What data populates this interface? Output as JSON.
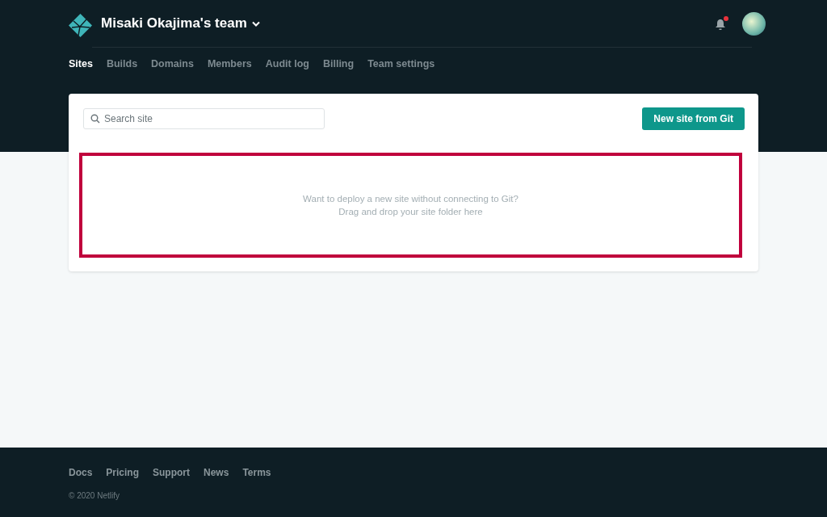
{
  "header": {
    "team_name": "Misaki Okajima's team",
    "notifications": {
      "unread": true
    }
  },
  "nav": [
    {
      "label": "Sites",
      "selected": true
    },
    {
      "label": "Builds",
      "selected": false
    },
    {
      "label": "Domains",
      "selected": false
    },
    {
      "label": "Members",
      "selected": false
    },
    {
      "label": "Audit log",
      "selected": false
    },
    {
      "label": "Billing",
      "selected": false
    },
    {
      "label": "Team settings",
      "selected": false
    }
  ],
  "search": {
    "placeholder": "Search site"
  },
  "new_site_button": "New site from Git",
  "drop_zone": {
    "lines": [
      "Want to deploy a new site without connecting to Git?",
      "Drag and drop your site folder here"
    ]
  },
  "footer": {
    "links": [
      "Docs",
      "Pricing",
      "Support",
      "News",
      "Terms"
    ],
    "copyright": "© 2020 Netlify"
  }
}
